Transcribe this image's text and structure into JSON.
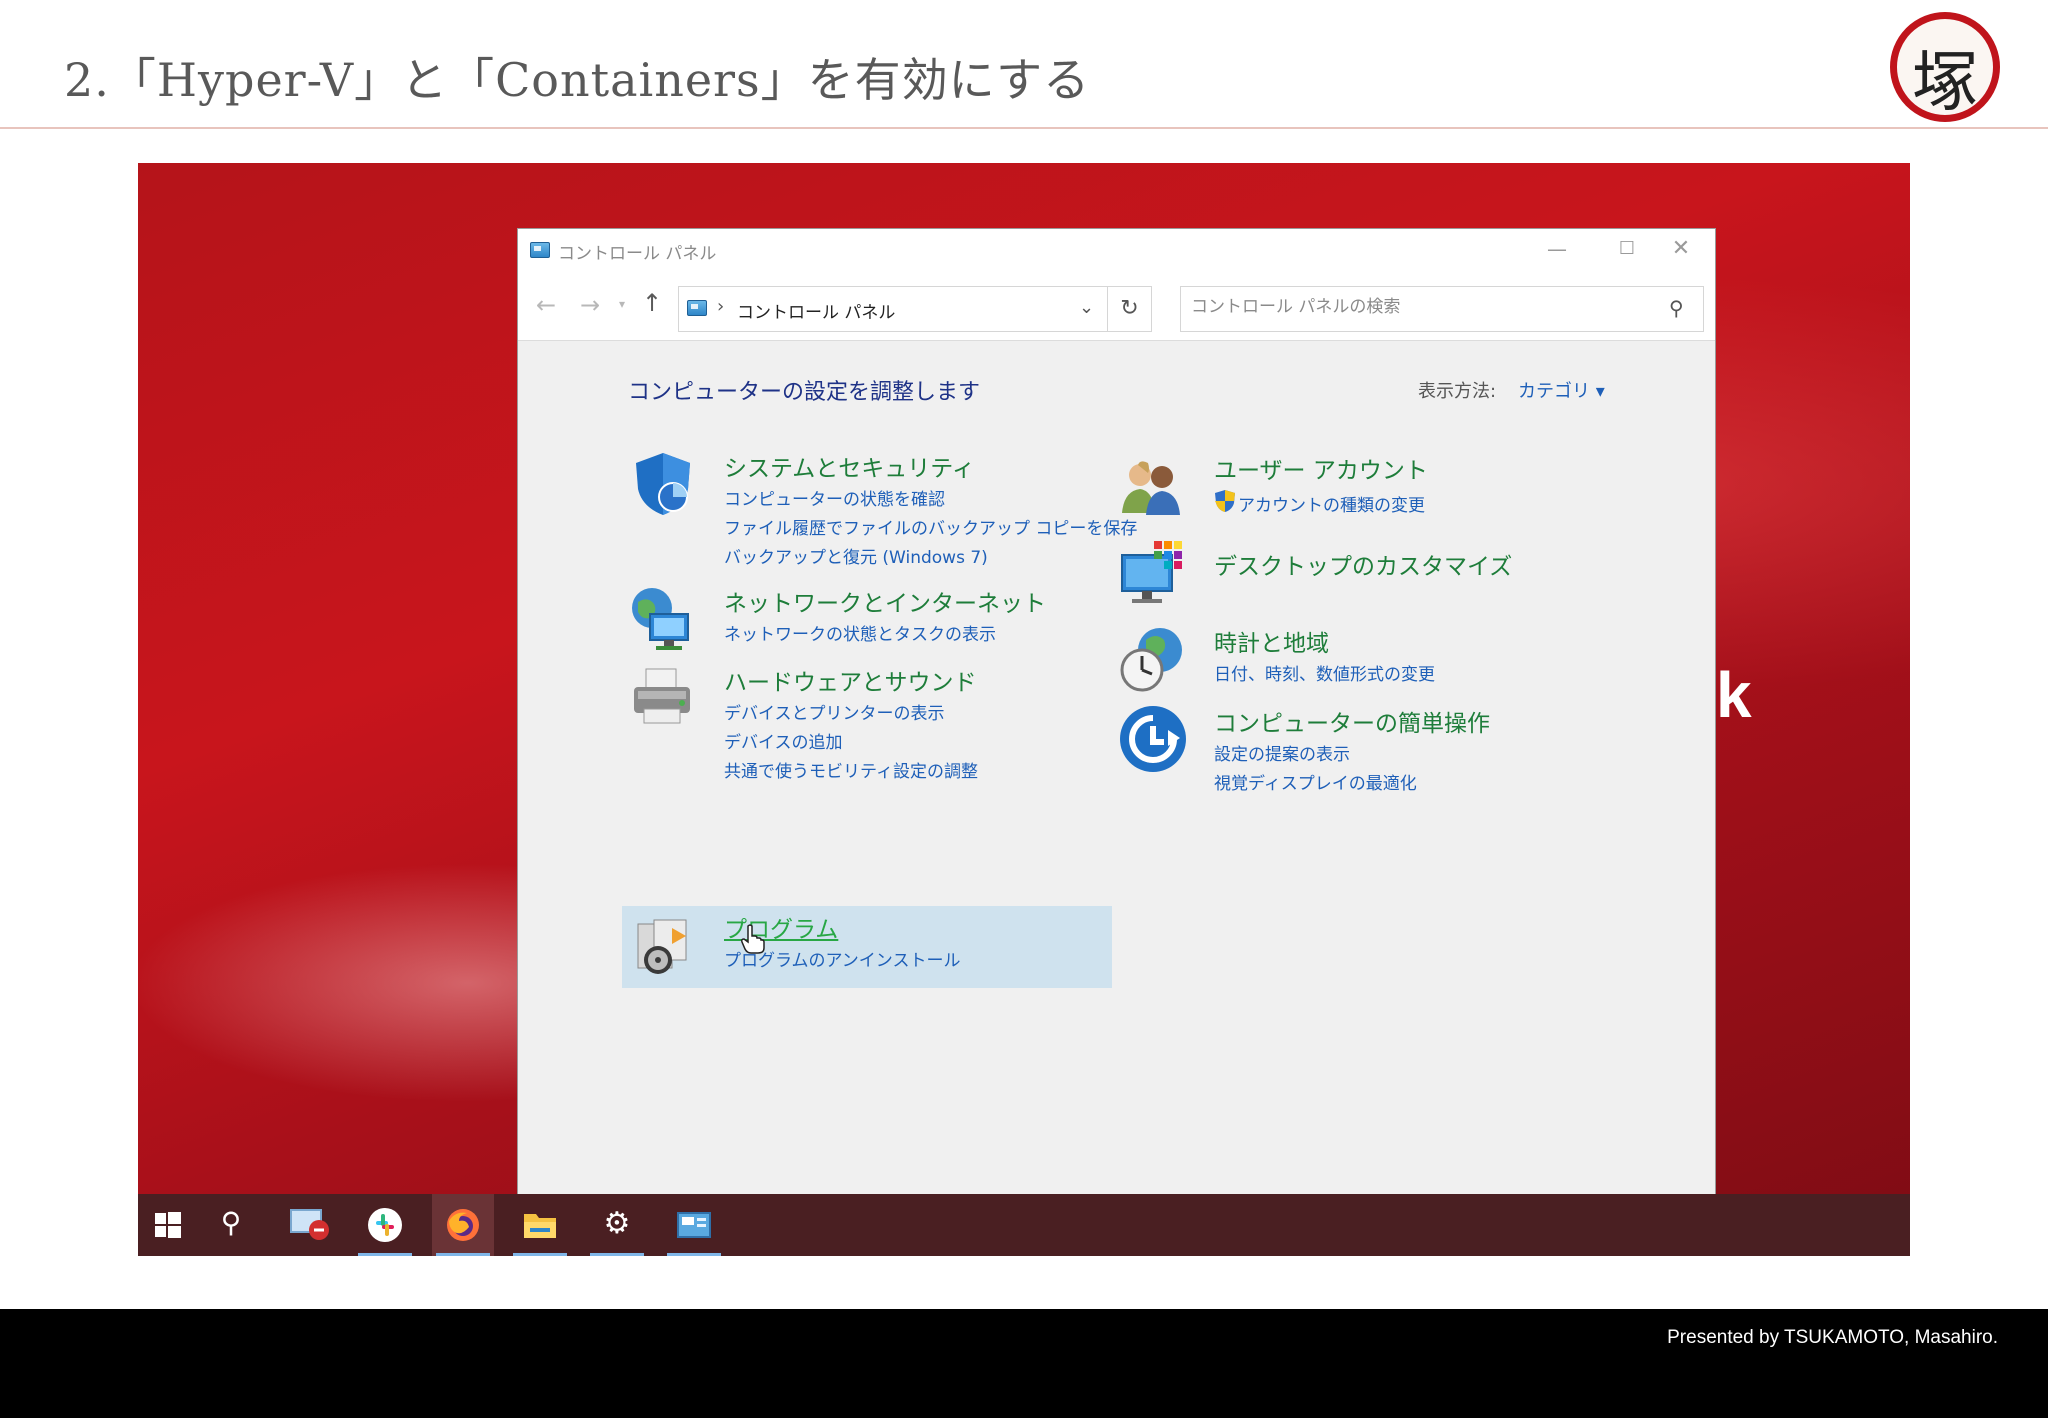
{
  "slide": {
    "title": "2.「Hyper-V」と「Containers」を有効にする",
    "logo_char": "塚",
    "footer": "Presented by TSUKAMOTO, Masahiro."
  },
  "wallpaper": {
    "text": "k"
  },
  "window": {
    "title": "コントロール パネル",
    "address": "コントロール パネル",
    "search_placeholder": "コントロール パネルの検索"
  },
  "content": {
    "heading": "コンピューターの設定を調整します",
    "view_label": "表示方法:",
    "view_value": "カテゴリ ▾"
  },
  "categories": {
    "system": {
      "title": "システムとセキュリティ",
      "links": [
        "コンピューターの状態を確認",
        "ファイル履歴でファイルのバックアップ コピーを保存",
        "バックアップと復元 (Windows 7)"
      ]
    },
    "network": {
      "title": "ネットワークとインターネット",
      "links": [
        "ネットワークの状態とタスクの表示"
      ]
    },
    "hardware": {
      "title": "ハードウェアとサウンド",
      "links": [
        "デバイスとプリンターの表示",
        "デバイスの追加",
        "共通で使うモビリティ設定の調整"
      ]
    },
    "programs": {
      "title": "プログラム",
      "links": [
        "プログラムのアンインストール"
      ]
    },
    "users": {
      "title": "ユーザー アカウント",
      "links": [
        "アカウントの種類の変更"
      ]
    },
    "desktop": {
      "title": "デスクトップのカスタマイズ",
      "links": []
    },
    "clock": {
      "title": "時計と地域",
      "links": [
        "日付、時刻、数値形式の変更"
      ]
    },
    "ease": {
      "title": "コンピューターの簡単操作",
      "links": [
        "設定の提案の表示",
        "視覚ディスプレイの最適化"
      ]
    }
  },
  "taskbar": {
    "items": [
      "windows-start",
      "search",
      "remote-desktop",
      "slack",
      "firefox",
      "file-explorer",
      "settings",
      "control-panel"
    ]
  },
  "colors": {
    "accent_red": "#c0141b",
    "category_green": "#1e7d3a",
    "link_blue": "#1e5fb8",
    "heading_blue": "#1e3287"
  }
}
